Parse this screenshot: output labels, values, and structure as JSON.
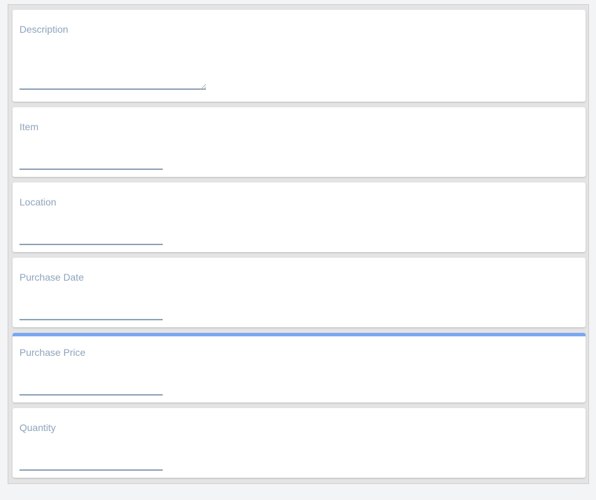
{
  "form": {
    "fields": [
      {
        "label": "Description",
        "value": "",
        "type": "textarea"
      },
      {
        "label": "Item",
        "value": "",
        "type": "text"
      },
      {
        "label": "Location",
        "value": "",
        "type": "text"
      },
      {
        "label": "Purchase Date",
        "value": "",
        "type": "text"
      },
      {
        "label": "Purchase Price",
        "value": "",
        "type": "text",
        "focused": true
      },
      {
        "label": "Quantity",
        "value": "",
        "type": "text"
      }
    ]
  },
  "colors": {
    "label": "#8ea4bb",
    "underline": "#8da2b5",
    "active_accent": "#7aa7f2",
    "card_background": "#ffffff",
    "container_background": "#e4e4e4",
    "page_background": "#f3f4f6"
  },
  "icons": {
    "resize": "textarea-resize-grip-icon"
  }
}
